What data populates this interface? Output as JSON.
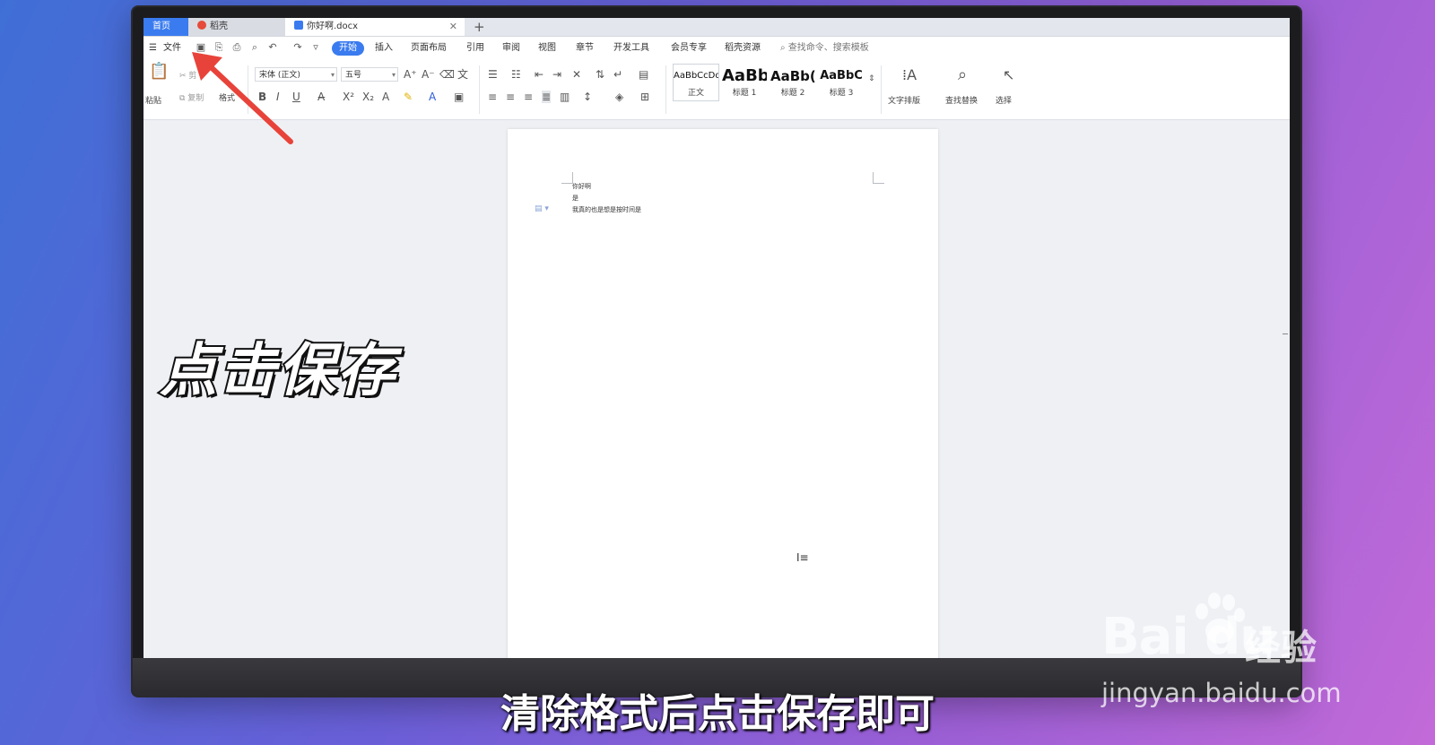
{
  "tabs": {
    "home": "首页",
    "docer": "稻壳",
    "doc": "你好啊.docx",
    "close": "✕",
    "add": "+"
  },
  "menu": {
    "file": "文件",
    "start": "开始",
    "insert": "插入",
    "layout": "页面布局",
    "reference": "引用",
    "review": "审阅",
    "view": "视图",
    "chapter": "章节",
    "devtools": "开发工具",
    "member": "会员专享",
    "docer_res": "稻壳资源",
    "search": "查找命令、搜索模板"
  },
  "ribbon": {
    "paste": "粘贴",
    "cut": "剪",
    "copy": "复制",
    "format_painter": "格式",
    "font_name": "宋体 (正文)",
    "font_size": "五号",
    "styles": [
      {
        "sample": "AaBbCcDd",
        "label": "正文"
      },
      {
        "sample": "AaBb",
        "label": "标题 1"
      },
      {
        "sample": "AaBb(",
        "label": "标题 2"
      },
      {
        "sample": "AaBbC",
        "label": "标题 3"
      }
    ],
    "text_layout": "文字排版",
    "find_replace": "查找替换",
    "select": "选择"
  },
  "document": {
    "lines": [
      "你好啊",
      "是",
      "我真的也是想是按时间是"
    ]
  },
  "overlay": {
    "title": "点击保存",
    "subtitle": "清除格式后点击保存即可"
  },
  "watermark": {
    "brand": "Bai du",
    "jingyan": "经验",
    "url": "jingyan.baidu.com"
  },
  "colors": {
    "accent": "#3a7bef",
    "arrow": "#e8433a"
  }
}
